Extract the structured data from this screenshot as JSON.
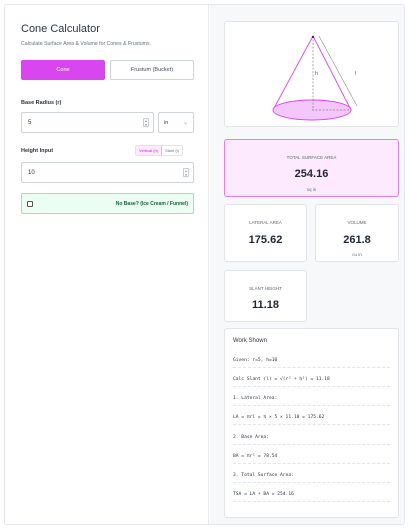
{
  "app": {
    "title": "Cone Calculator",
    "subtitle": "Calculate Surface Area & Volume for Cones & Frustums."
  },
  "modes": {
    "cone_label": "Cone",
    "frustum_label": "Frustum (Bucket)",
    "selected": "Cone"
  },
  "radius": {
    "label": "Base Radius (r)",
    "value": "5",
    "unit": "in"
  },
  "height": {
    "label": "Height Input",
    "value": "10",
    "toggle_vertical": "Vertical (h)",
    "toggle_slant": "Slant (l)"
  },
  "no_base": {
    "label": "No Base? (Ice Cream / Funnel)",
    "checked": false
  },
  "diagram": {
    "h_label": "h",
    "l_label": "l"
  },
  "results": {
    "total": {
      "label": "TOTAL SURFACE AREA",
      "value": "254.16",
      "unit": "sq in"
    },
    "lateral": {
      "label": "LATERAL AREA",
      "value": "175.62"
    },
    "volume": {
      "label": "VOLUME",
      "value": "261.8",
      "unit": "cu in"
    },
    "slant": {
      "label": "SLANT HEIGHT",
      "value": "11.18"
    }
  },
  "work": {
    "title": "Work Shown",
    "lines": [
      "Given: r=5, h=10",
      "Calc Slant (l) = √(r² + h²) = 11.18",
      "1. Lateral Area:",
      "LA = πrl = π × 5 × 11.18 = 175.62",
      "2. Base Area:",
      "BA = πr² = 78.54",
      "3. Total Surface Area:",
      "TSA = LA + BA = 254.16"
    ]
  },
  "colors": {
    "accent": "#d946ef",
    "accent_light": "#fdeafe",
    "success_bg": "#ecfdf3",
    "success_text": "#166534"
  }
}
